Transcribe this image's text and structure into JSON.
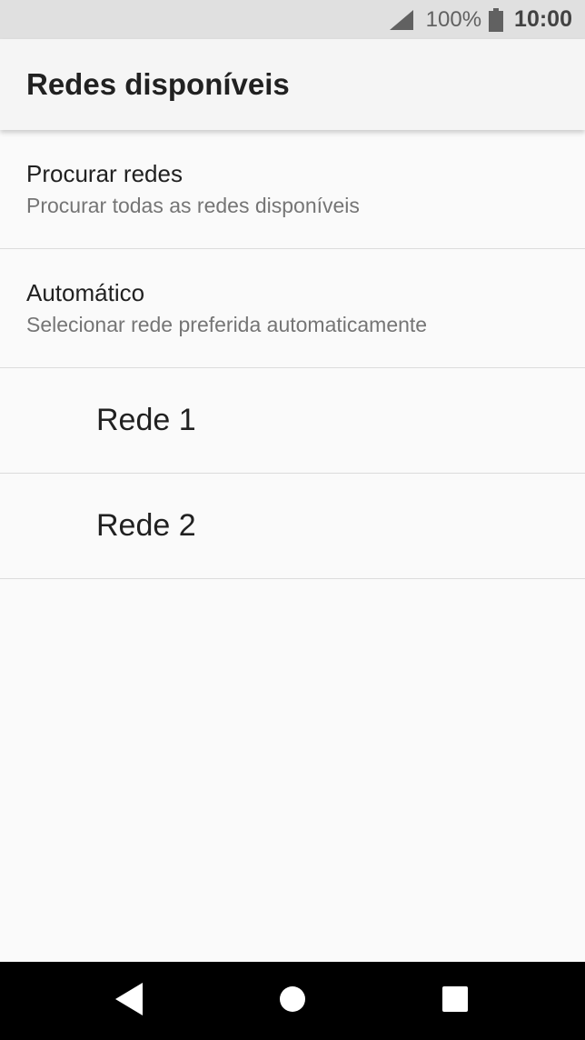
{
  "status_bar": {
    "battery_percent": "100%",
    "time": "10:00",
    "icons": [
      "signal-icon",
      "battery-icon"
    ]
  },
  "app_bar": {
    "title": "Redes disponíveis"
  },
  "list": {
    "search": {
      "title": "Procurar redes",
      "subtitle": "Procurar todas as redes disponíveis"
    },
    "automatic": {
      "title": "Automático",
      "subtitle": "Selecionar rede preferida automaticamente"
    },
    "networks": [
      {
        "label": "Rede 1"
      },
      {
        "label": "Rede 2"
      }
    ]
  },
  "nav_bar": {
    "icons": [
      "back-icon",
      "home-icon",
      "recents-icon"
    ]
  },
  "colors": {
    "status_bar_bg": "#e0e0e0",
    "app_bar_bg": "#f5f5f5",
    "page_bg": "#fafafa",
    "nav_bar_bg": "#000000",
    "primary_text": "#212121",
    "secondary_text": "#757575"
  }
}
